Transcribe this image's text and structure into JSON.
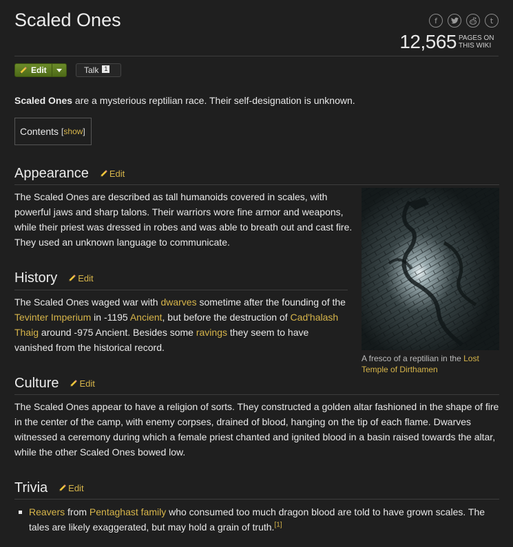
{
  "page": {
    "title": "Scaled Ones"
  },
  "social": [
    {
      "icon": "facebook-icon",
      "glyph": "f"
    },
    {
      "icon": "twitter-icon",
      "glyph": "t"
    },
    {
      "icon": "reddit-icon",
      "glyph": "r"
    },
    {
      "icon": "tumblr-icon",
      "glyph": "t"
    }
  ],
  "wiki_stats": {
    "page_count": "12,565",
    "label_line1": "PAGES ON",
    "label_line2": "THIS WIKI"
  },
  "actions": {
    "edit_label": "Edit",
    "talk_label": "Talk",
    "talk_count": "1"
  },
  "intro": {
    "bold": "Scaled Ones",
    "rest": " are a mysterious reptilian race. Their self-designation is unknown."
  },
  "toc": {
    "label": "Contents",
    "bracket_open": "[",
    "toggle": "show",
    "bracket_close": "]"
  },
  "sections": {
    "edit_label": "Edit",
    "appearance": {
      "heading": "Appearance",
      "text": "The Scaled Ones are described as tall humanoids covered in scales, with powerful jaws and sharp talons. Their warriors wore fine armor and weapons, while their priest was dressed in robes and was able to breath out and cast fire. They used an unknown language to communicate."
    },
    "history": {
      "heading": "History",
      "t1": "The Scaled Ones waged war with ",
      "l1": "dwarves",
      "t2": " sometime after the founding of the ",
      "l2": "Tevinter Imperium",
      "t3": " in -1195 ",
      "l3": "Ancient",
      "t4": ", but before the destruction of ",
      "l4": "Cad'halash Thaig",
      "t5": " around -975 Ancient. Besides some ",
      "l5": "ravings",
      "t6": " they seem to have vanished from the historical record."
    },
    "culture": {
      "heading": "Culture",
      "text": "The Scaled Ones appear to have a religion of sorts. They constructed a golden altar fashioned in the shape of fire in the center of the camp, with enemy corpses, drained of blood, hanging on the tip of each flame. Dwarves witnessed a ceremony during which a female priest chanted and ignited blood in a basin raised towards the altar, while the other Scaled Ones bowed low."
    },
    "trivia": {
      "heading": "Trivia",
      "l1": "Reavers",
      "t1": " from ",
      "l2": "Pentaghast family",
      "t2": " who consumed too much dragon blood are told to have grown scales. The tales are likely exaggerated, but may hold a grain of truth.",
      "ref": "[1]"
    }
  },
  "figure": {
    "caption_text": "A fresco of a reptilian in the ",
    "caption_link": "Lost Temple of Dirthamen"
  },
  "colors": {
    "background": "#1f1f1f",
    "link": "#d7b54a",
    "edit_button": "#5b7a20"
  }
}
